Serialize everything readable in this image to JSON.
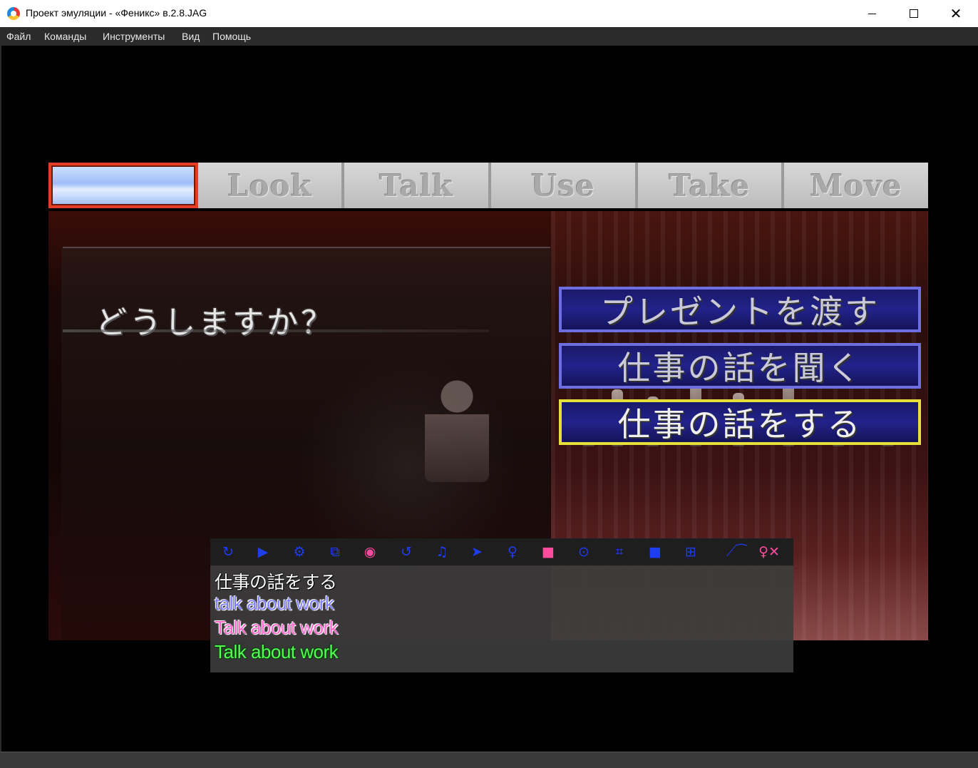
{
  "window": {
    "title": "Проект эмуляции - «Феникс» в.2.8.JAG",
    "controls": {
      "minimize": "—",
      "maximize": "☐",
      "close": "✕"
    }
  },
  "menu": {
    "items": [
      "Файл",
      "Команды",
      "Инструменты",
      "Вид",
      "Помощь"
    ]
  },
  "game": {
    "commands": [
      "",
      "Look",
      "Talk",
      "Use",
      "Take",
      "Move"
    ],
    "selected_command_index": 0,
    "prompt": "どうしますか？",
    "choices": [
      "プレゼントを渡す",
      "仕事の話を聞く",
      "仕事の話をする"
    ],
    "selected_choice_index": 2,
    "colors": {
      "choice_border": "#6e6ee0",
      "choice_selected_border": "#e8e03a",
      "command_active_border": "#e53d24"
    }
  },
  "overlay": {
    "toolbar_icons": [
      "refresh-icon",
      "play-icon",
      "gear-icon",
      "copy-icon",
      "eye-icon",
      "undo-icon",
      "music-icon",
      "cursor-icon",
      "lightbulb-icon",
      "lock-icon",
      "gamepad-icon",
      "crop-icon",
      "square-icon",
      "windows-icon",
      "graph-icon",
      "search-clear-icon"
    ],
    "subtitles": {
      "original": "仕事の話をする",
      "translation_1": "talk about work",
      "translation_2": "Talk about work",
      "translation_3": "Talk about work"
    },
    "colors": {
      "icon": "#1e3cf0",
      "icon_alt": "#ff4c9e",
      "sub_blue": "#7d7dff",
      "sub_pink": "#ff66cc",
      "sub_green": "#55ff55"
    }
  }
}
